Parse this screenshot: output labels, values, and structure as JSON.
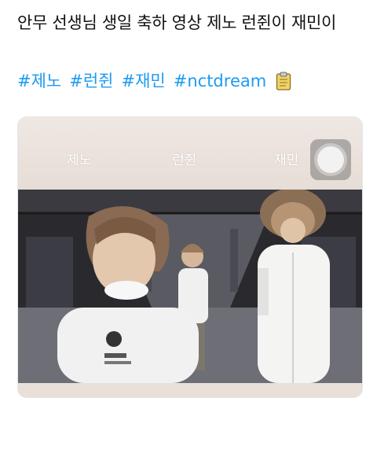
{
  "tweet": {
    "text": "안무 선생님 생일 축하 영상 제노 런쥔이 재민이",
    "hashtags": [
      "#제노",
      "#런쥔",
      "#재민",
      "#nctdream"
    ],
    "emoji_icon": "clipboard-icon"
  },
  "media": {
    "name_tags": [
      "제노",
      "런쥔",
      "재민"
    ],
    "assistive_touch_icon": "assistive-touch-icon",
    "accent_colors": {
      "hashtag": "#1d9bf0",
      "text": "#111111",
      "card_bg": "#e9e2dc"
    }
  }
}
